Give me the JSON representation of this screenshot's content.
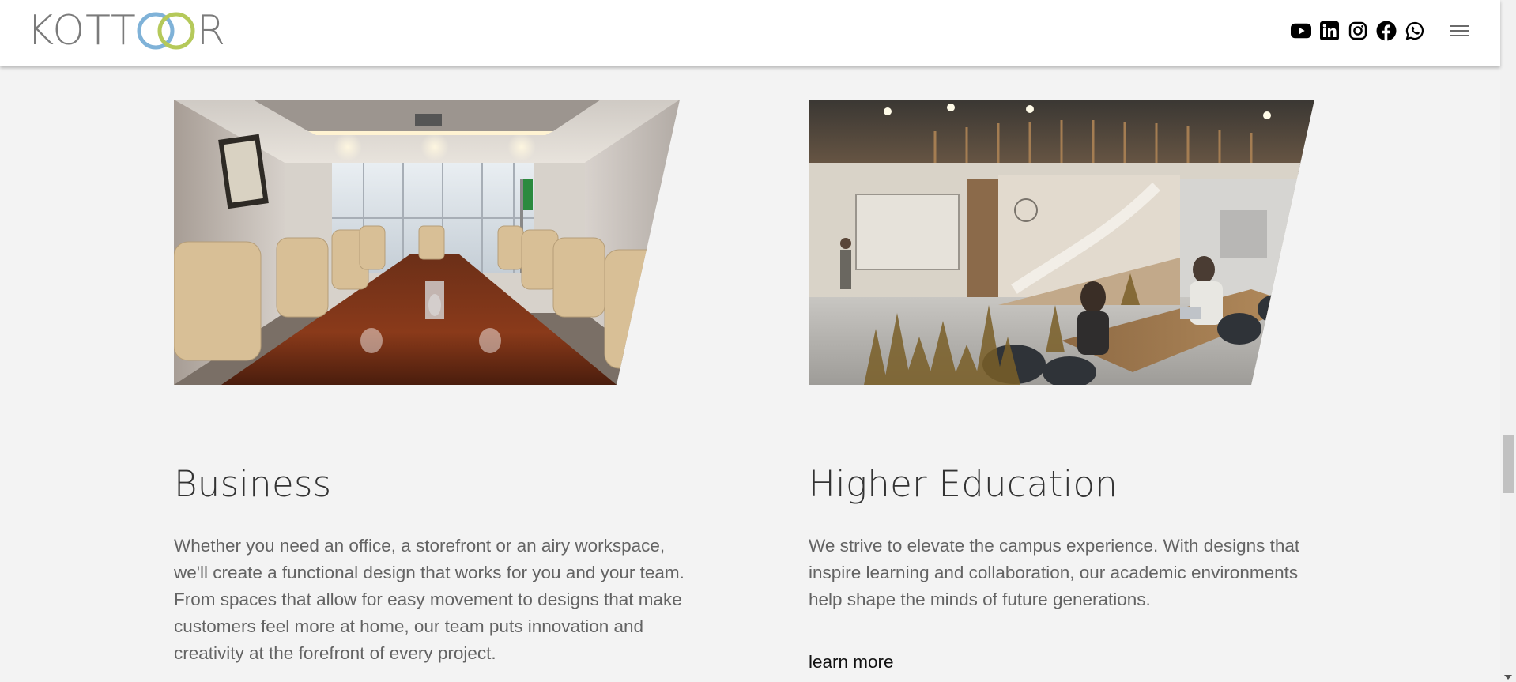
{
  "header": {
    "logo_text": "KOTTOOR",
    "logo_parts": {
      "pre": "KOTT",
      "post": "R"
    },
    "social_icons": [
      "youtube-icon",
      "linkedin-icon",
      "instagram-icon",
      "facebook-icon",
      "whatsapp-icon"
    ],
    "menu_icon": "hamburger-menu-icon"
  },
  "colors": {
    "logo_grey": "#7b7b7b",
    "logo_ring_blue": "#7fb2d8",
    "logo_ring_green": "#b5c95a",
    "page_bg": "#f3f3f3",
    "title_text": "#333333",
    "body_text": "#636363"
  },
  "cards": [
    {
      "title": "Business",
      "description": "Whether you need an office, a storefront or an airy workspace, we'll create a functional design that works for you and your team. From spaces that allow for easy movement to designs that make customers feel more at home, our team puts innovation and creativity at the forefront of every project.",
      "image_alt": "conference room with wooden table and beige chairs"
    },
    {
      "title": "Higher Education",
      "description": "We strive to elevate the campus experience. With designs that inspire learning and collaboration, our academic environments help shape the minds of future generations.",
      "link": "learn more",
      "image_alt": "modern campus interior with glass walls and students at a table"
    }
  ]
}
